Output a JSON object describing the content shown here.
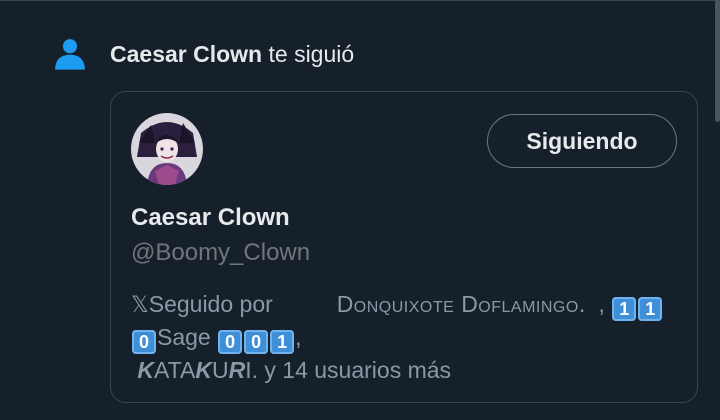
{
  "notification": {
    "follower_name": "Caesar Clown",
    "action_text": "te siguió"
  },
  "card": {
    "button_label": "Siguiendo",
    "display_name": "Caesar Clown",
    "handle": "@Boomy_Clown",
    "followed_by": {
      "prefix": "Seguido por",
      "user1": "Donquixote Doflamingo.",
      "comma1": ",",
      "user2_digits": [
        "1",
        "1",
        "0"
      ],
      "user2_mid": "Sage",
      "user2_digits_end": [
        "0",
        "0",
        "1"
      ],
      "comma2": ",",
      "user3_a": "K",
      "user3_b": "ATA",
      "user3_c": "K",
      "user3_d": "U",
      "user3_e": "R",
      "user3_f": "I",
      "suffix": ". y 14 usuarios más"
    }
  },
  "colors": {
    "background": "#15202b",
    "border": "#38444d",
    "accent_blue": "#1d9bf0",
    "muted_text": "#71767b"
  }
}
